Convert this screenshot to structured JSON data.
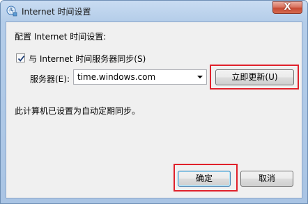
{
  "window": {
    "title": "Internet 时间设置",
    "close_glyph": "X"
  },
  "settings": {
    "heading": "配置 Internet 时间设置:",
    "sync_checkbox": {
      "label": "与 Internet 时间服务器同步(S)",
      "checked": true
    },
    "server": {
      "label": "服务器(E):",
      "value": "time.windows.com"
    },
    "update_now_label": "立即更新(U)",
    "status_text": "此计算机已设置为自动定期同步。"
  },
  "footer": {
    "ok_label": "确定",
    "cancel_label": "取消"
  },
  "highlights": {
    "color": "#e0202a"
  },
  "icons": {
    "title": "network-clock-icon",
    "dropdown": "chevron-down-icon",
    "check": "checkmark-icon"
  }
}
